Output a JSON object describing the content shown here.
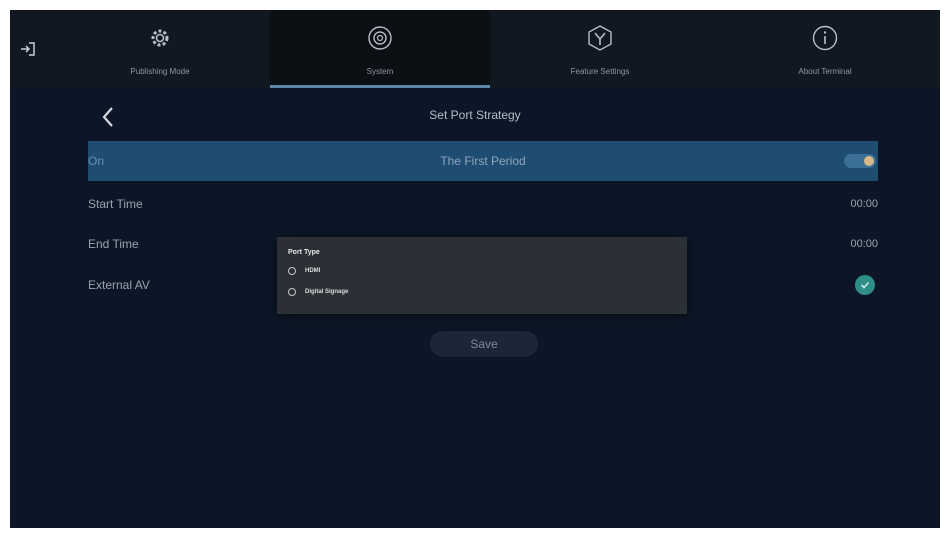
{
  "nav": {
    "tabs": [
      {
        "label": "Publishing Mode",
        "icon": "gear-icon"
      },
      {
        "label": "System",
        "icon": "settings-icon"
      },
      {
        "label": "Feature Settings",
        "icon": "feature-settings-icon"
      },
      {
        "label": "About Terminal",
        "icon": "info-icon"
      }
    ],
    "active_tab": "System"
  },
  "page": {
    "title": "Set Port Strategy",
    "period_row": {
      "left": "On",
      "center": "The First Period",
      "toggle_on": true
    },
    "start_time": {
      "label": "Start Time",
      "value": "00:00"
    },
    "end_time": {
      "label": "End Time",
      "value": "00:00"
    },
    "external_av": {
      "label": "External AV",
      "checked": true
    },
    "save_label": "Save"
  },
  "dialog": {
    "title": "Port Type",
    "options": [
      "HDMI",
      "Digital Signage"
    ]
  },
  "colors": {
    "background": "#0c1626",
    "nav_bg": "#121821",
    "selected_row": "#1f4d72",
    "accent": "#5a88a8",
    "check": "#2f8f88",
    "toggle_knob": "#d8b98a"
  }
}
